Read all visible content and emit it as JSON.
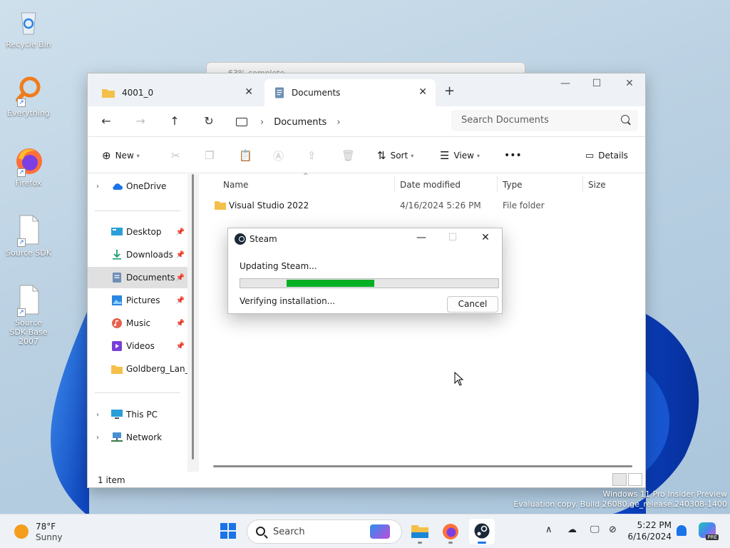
{
  "desktop": {
    "icons": [
      {
        "label": "Recycle Bin"
      },
      {
        "label": "Everything"
      },
      {
        "label": "Firefox"
      },
      {
        "label": "Source SDK"
      },
      {
        "label": "Source SDK Base 2007"
      }
    ]
  },
  "background_window": {
    "title": "63% complete"
  },
  "explorer": {
    "tabs": [
      {
        "label": "4001_0",
        "active": false
      },
      {
        "label": "Documents",
        "active": true
      }
    ],
    "new_tab_glyph": "+",
    "window_controls": {
      "minimize": "—",
      "maximize": "☐",
      "close": "✕"
    },
    "address": {
      "crumbs": [
        "Documents"
      ]
    },
    "search": {
      "placeholder": "Search Documents"
    },
    "commands": {
      "new": "New",
      "sort": "Sort",
      "view": "View",
      "more": "•••",
      "details": "Details"
    },
    "nav_pane": {
      "top": [
        {
          "label": "OneDrive",
          "icon": "cloud-icon"
        }
      ],
      "quick_access": [
        {
          "label": "Desktop",
          "icon": "desktop-icon"
        },
        {
          "label": "Downloads",
          "icon": "download-icon"
        },
        {
          "label": "Documents",
          "icon": "document-icon",
          "selected": true
        },
        {
          "label": "Pictures",
          "icon": "pictures-icon"
        },
        {
          "label": "Music",
          "icon": "music-icon"
        },
        {
          "label": "Videos",
          "icon": "video-icon"
        },
        {
          "label": "Goldberg_Lan_S",
          "icon": "folder-icon"
        }
      ],
      "bottom": [
        {
          "label": "This PC",
          "icon": "pc-icon"
        },
        {
          "label": "Network",
          "icon": "network-icon"
        }
      ]
    },
    "columns": [
      "Name",
      "Date modified",
      "Type",
      "Size"
    ],
    "files": [
      {
        "name": "Visual Studio 2022",
        "date": "4/16/2024 5:26 PM",
        "type": "File folder",
        "size": ""
      }
    ],
    "status": {
      "count": "1 item"
    }
  },
  "steam_dialog": {
    "title": "Steam",
    "status_line": "Updating Steam...",
    "detail_line": "Verifying installation...",
    "cancel_label": "Cancel",
    "progress": {
      "start": 0.18,
      "end": 0.52
    },
    "progress_color": "#06b025"
  },
  "watermark": {
    "line1": "Windows 11 Pro Insider Preview",
    "line2": "Evaluation copy. Build 26080.ge_release.240308-1400"
  },
  "taskbar": {
    "weather": {
      "temp": "78°F",
      "condition": "Sunny"
    },
    "search_label": "Search",
    "clock": {
      "time": "5:22 PM",
      "date": "6/16/2024"
    },
    "copilot_badge": "PRE"
  },
  "colors": {
    "accent": "#1a73e8",
    "folder": "#f5c04a"
  }
}
